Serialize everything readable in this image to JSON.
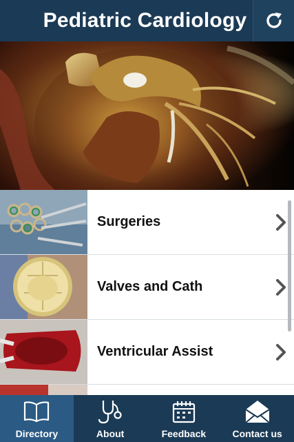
{
  "header": {
    "title": "Pediatric Cardiology",
    "refresh_icon": "refresh-icon"
  },
  "menu": {
    "items": [
      {
        "label": "Surgeries",
        "thumb": "surgical-clamps-photo"
      },
      {
        "label": "Valves and Cath",
        "thumb": "heart-valve-photo"
      },
      {
        "label": "Ventricular Assist",
        "thumb": "ventricular-assist-device-photo"
      }
    ]
  },
  "tabs": [
    {
      "label": "Directory",
      "icon": "book-icon",
      "active": true
    },
    {
      "label": "About",
      "icon": "stethoscope-icon",
      "active": false
    },
    {
      "label": "Feedback",
      "icon": "calendar-icon",
      "active": false
    },
    {
      "label": "Contact us",
      "icon": "envelope-icon",
      "active": false
    }
  ],
  "colors": {
    "header_bg": "#1b3a55",
    "tab_active_bg": "#2b5a84",
    "list_bg": "#ffffff",
    "chevron": "#555555"
  }
}
